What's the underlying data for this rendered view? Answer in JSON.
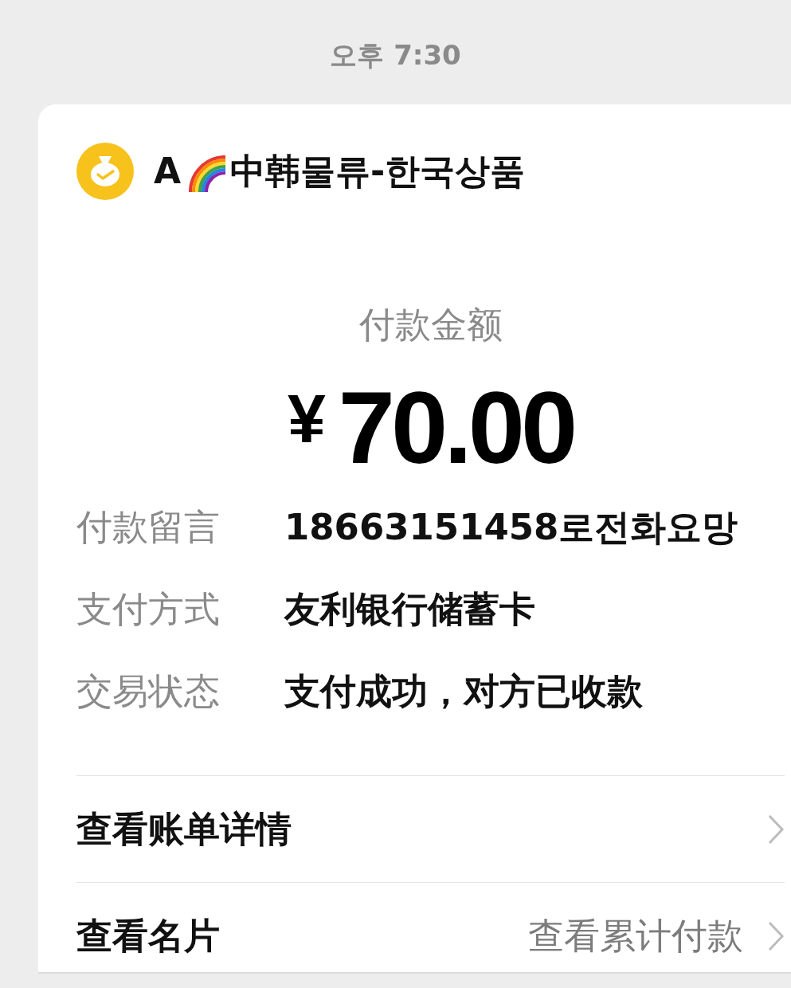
{
  "status_bar": {
    "time": "오후 7:30"
  },
  "merchant": {
    "initial": "A",
    "name": "中韩물류-한국상품"
  },
  "payment": {
    "title": "付款金额",
    "currency": "¥",
    "amount": "70.00"
  },
  "details": [
    {
      "label": "付款留言",
      "value": "18663151458로전화요망"
    },
    {
      "label": "支付方式",
      "value": "友利银行储蓄卡"
    },
    {
      "label": "交易状态",
      "value": "支付成功，对方已收款"
    }
  ],
  "links": [
    {
      "label": "查看账单详情"
    },
    {
      "label": "查看名片",
      "hint": "查看累计付款"
    }
  ]
}
